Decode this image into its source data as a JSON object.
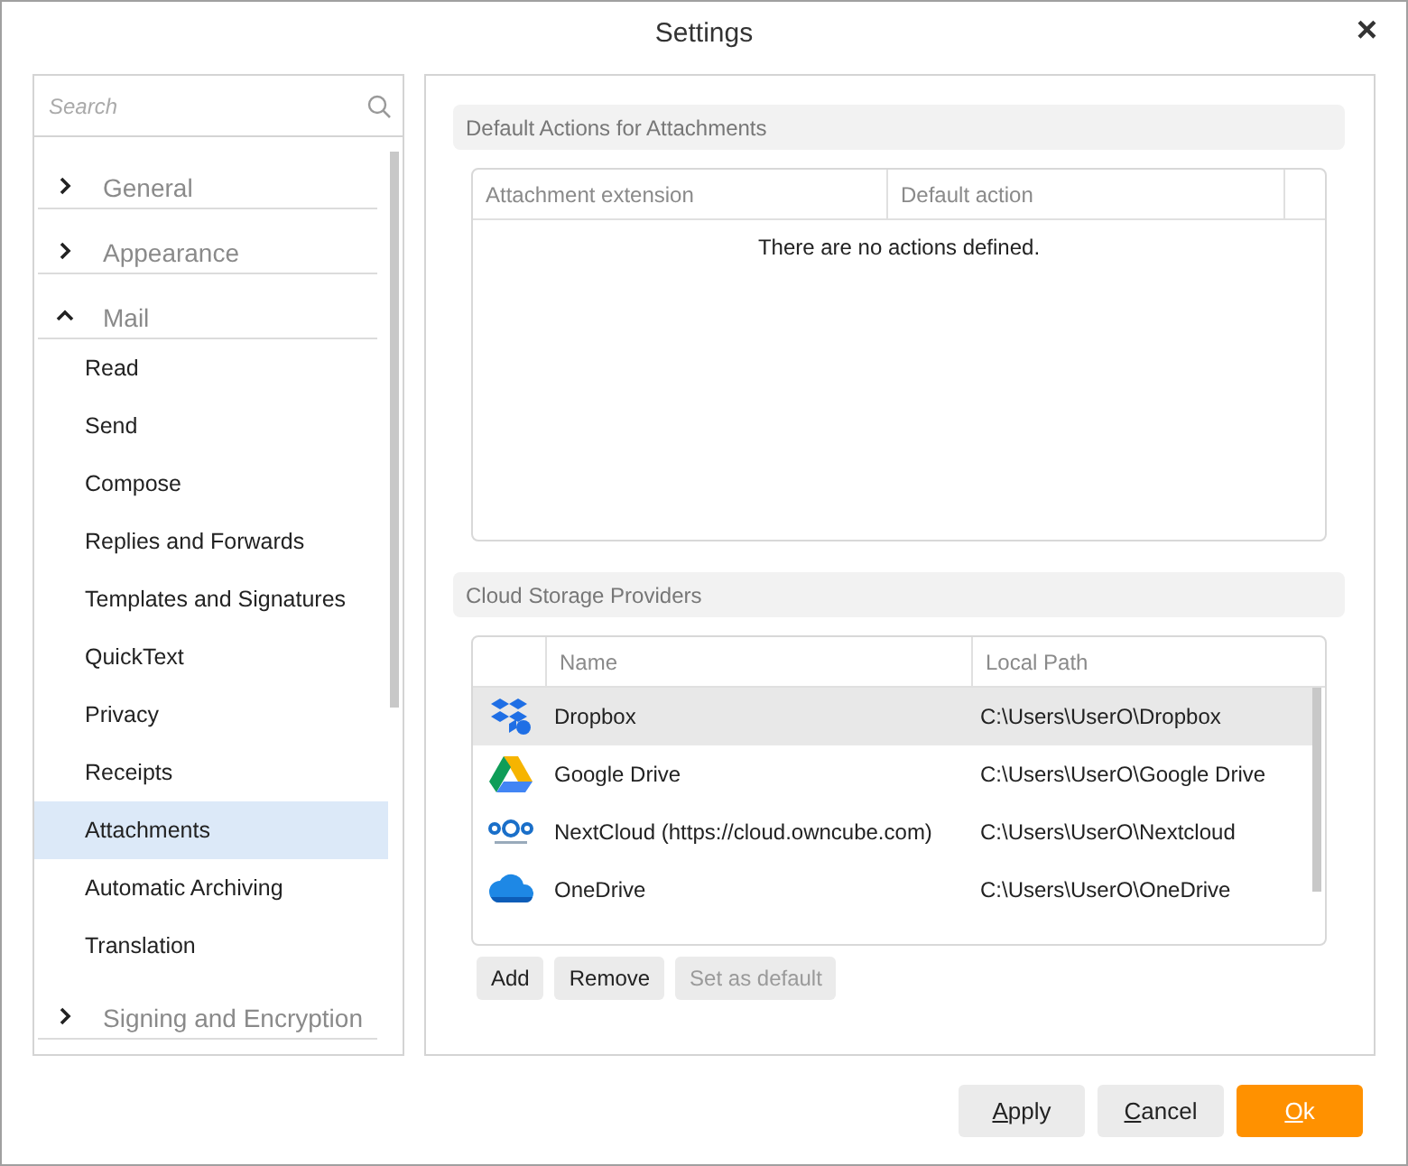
{
  "window": {
    "title": "Settings",
    "close": "×"
  },
  "sidebar": {
    "search": {
      "placeholder": "Search"
    },
    "categories": [
      {
        "label": "General",
        "expanded": false
      },
      {
        "label": "Appearance",
        "expanded": false
      },
      {
        "label": "Mail",
        "expanded": true,
        "children": [
          {
            "label": "Read",
            "selected": false
          },
          {
            "label": "Send",
            "selected": false
          },
          {
            "label": "Compose",
            "selected": false
          },
          {
            "label": "Replies and Forwards",
            "selected": false
          },
          {
            "label": "Templates and Signatures",
            "selected": false
          },
          {
            "label": "QuickText",
            "selected": false
          },
          {
            "label": "Privacy",
            "selected": false
          },
          {
            "label": "Receipts",
            "selected": false
          },
          {
            "label": "Attachments",
            "selected": true
          },
          {
            "label": "Automatic Archiving",
            "selected": false
          },
          {
            "label": "Translation",
            "selected": false
          }
        ]
      },
      {
        "label": "Signing and Encryption",
        "expanded": false
      }
    ]
  },
  "attachments_section": {
    "title": "Default Actions for Attachments",
    "columns": [
      "Attachment extension",
      "Default action"
    ],
    "empty_message": "There are no actions defined."
  },
  "cloud_section": {
    "title": "Cloud Storage Providers",
    "columns": [
      "Name",
      "Local Path"
    ],
    "rows": [
      {
        "kind": "dropbox",
        "name": "Dropbox",
        "path": "C:\\Users\\UserO\\Dropbox",
        "selected": true
      },
      {
        "kind": "gdrive",
        "name": "Google Drive",
        "path": "C:\\Users\\UserO\\Google Drive",
        "selected": false
      },
      {
        "kind": "nextcloud",
        "name": "NextCloud (https://cloud.owncube.com)",
        "path": "C:\\Users\\UserO\\Nextcloud",
        "selected": false
      },
      {
        "kind": "onedrive",
        "name": "OneDrive",
        "path": "C:\\Users\\UserO\\OneDrive",
        "selected": false
      }
    ],
    "buttons": [
      {
        "label": "Add",
        "disabled": false
      },
      {
        "label": "Remove",
        "disabled": false
      },
      {
        "label": "Set as default",
        "disabled": true
      }
    ]
  },
  "footer_buttons": [
    {
      "label": "Apply",
      "kind": "secondary"
    },
    {
      "label": "Cancel",
      "kind": "secondary"
    },
    {
      "label": "Ok",
      "kind": "primary"
    }
  ]
}
